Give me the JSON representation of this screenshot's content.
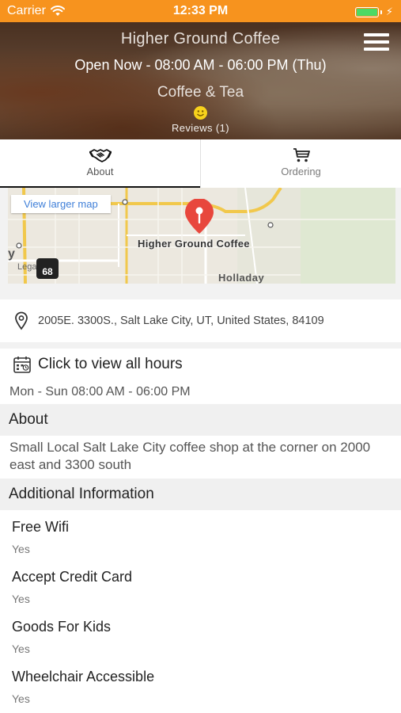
{
  "status_bar": {
    "carrier": "Carrier",
    "time": "12:33 PM",
    "icons": [
      "wifi-icon",
      "battery-icon",
      "charging-bolt-icon"
    ],
    "color": "#f7931e"
  },
  "header": {
    "title": "Higher Ground Coffee",
    "hours": "Open Now - 08:00 AM - 06:00 PM (Thu)",
    "category": "Coffee & Tea",
    "reviews": "Reviews (1)",
    "icons": [
      "smiley-icon",
      "menu-icon"
    ]
  },
  "tabs": [
    {
      "label": "About",
      "icon": "handshake-icon",
      "active": true
    },
    {
      "label": "Ordering",
      "icon": "cart-icon",
      "active": false
    }
  ],
  "map": {
    "view_larger": "View larger map",
    "place_label": "Higher Ground Coffee",
    "area_label": "Holladay",
    "edge_letter": "y",
    "legal": "Legal",
    "route_shield": "68",
    "pin_color": "#e8473d"
  },
  "address": {
    "text": "2005E. 3300S., Salt Lake City, UT, United States, 84109",
    "icon": "location-pin-icon"
  },
  "hours": {
    "title": "Click to view all hours",
    "detail": "Mon - Sun 08:00 AM - 06:00 PM",
    "icon": "calendar-icon"
  },
  "about": {
    "heading": "About",
    "text": "Small Local Salt Lake City coffee shop at the corner on 2000 east and 3300 south"
  },
  "additional": {
    "heading": "Additional Information",
    "items": [
      {
        "label": "Free Wifi",
        "value": "Yes"
      },
      {
        "label": "Accept Credit Card",
        "value": "Yes"
      },
      {
        "label": "Goods For Kids",
        "value": "Yes"
      },
      {
        "label": "Wheelchair Accessible",
        "value": "Yes"
      }
    ]
  }
}
